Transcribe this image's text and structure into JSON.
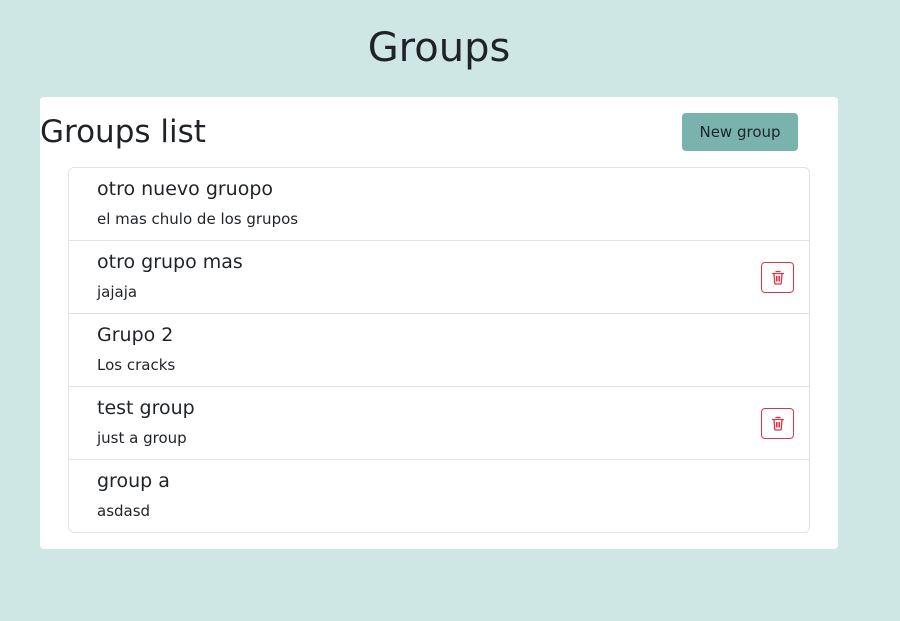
{
  "page": {
    "title": "Groups"
  },
  "card": {
    "title": "Groups list",
    "new_group_label": "New group"
  },
  "groups": [
    {
      "name": "otro nuevo gruopo",
      "description": "el mas chulo de los grupos",
      "deletable": false
    },
    {
      "name": "otro grupo mas",
      "description": "jajaja",
      "deletable": true
    },
    {
      "name": "Grupo 2",
      "description": "Los cracks",
      "deletable": false
    },
    {
      "name": "test group",
      "description": "just a group",
      "deletable": true
    },
    {
      "name": "group a",
      "description": "asdasd",
      "deletable": false
    }
  ],
  "icons": {
    "delete": "trash-icon"
  },
  "colors": {
    "background": "#cfe7e4",
    "accent": "#7ab3ae",
    "danger": "#dc3545"
  }
}
